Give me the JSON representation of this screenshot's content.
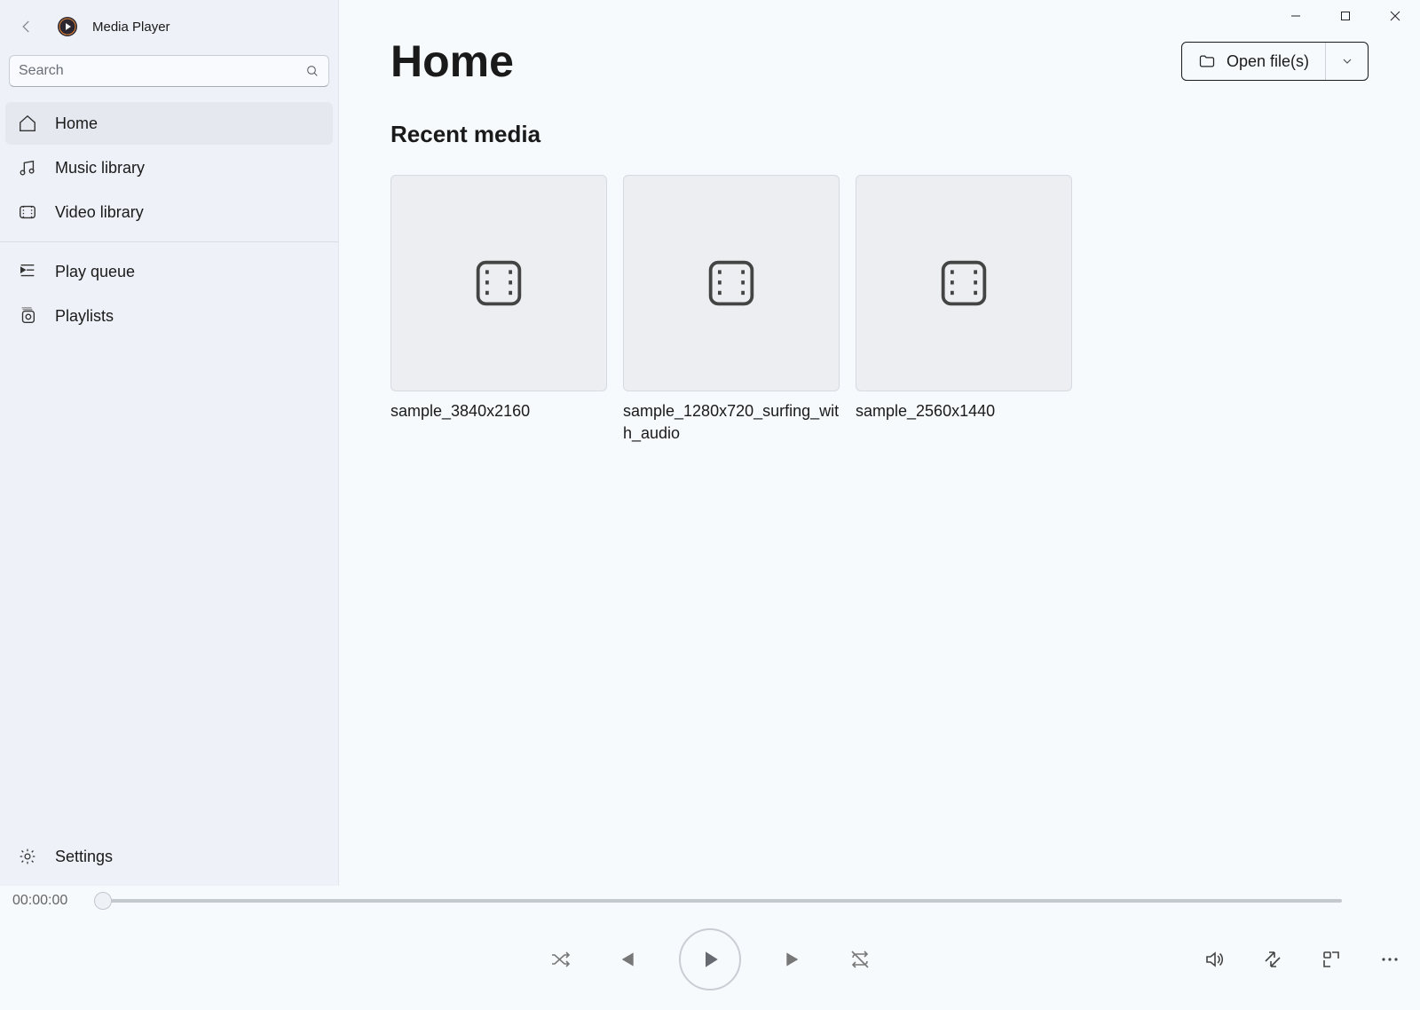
{
  "app": {
    "title": "Media Player"
  },
  "search": {
    "placeholder": "Search"
  },
  "sidebar": {
    "items": [
      {
        "label": "Home",
        "selected": true
      },
      {
        "label": "Music library",
        "selected": false
      },
      {
        "label": "Video library",
        "selected": false
      }
    ],
    "secondary": [
      {
        "label": "Play queue"
      },
      {
        "label": "Playlists"
      }
    ],
    "settings_label": "Settings"
  },
  "header": {
    "page_title": "Home",
    "open_files_label": "Open file(s)"
  },
  "recent": {
    "section_title": "Recent media",
    "items": [
      {
        "title": "sample_3840x2160"
      },
      {
        "title": "sample_1280x720_surfing_with_audio"
      },
      {
        "title": "sample_2560x1440"
      }
    ]
  },
  "player": {
    "position_label": "00:00:00"
  }
}
